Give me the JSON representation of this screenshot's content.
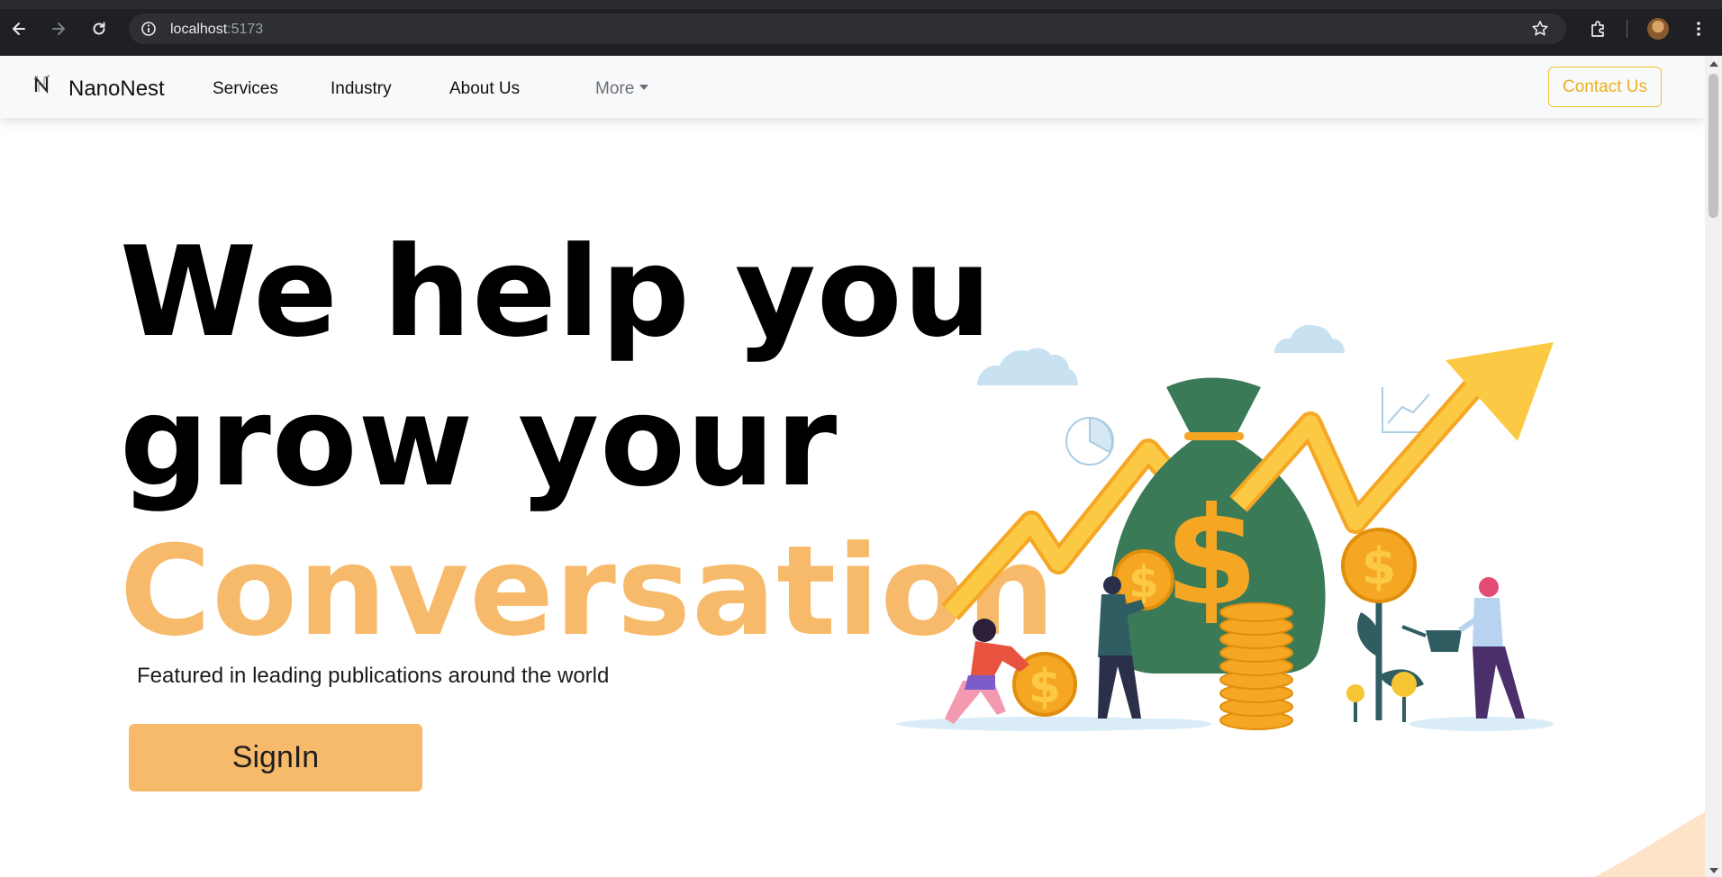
{
  "browser": {
    "url_host": "localhost",
    "url_port": ":5173"
  },
  "navbar": {
    "brand": "NanoNest",
    "links": [
      "Services",
      "Industry",
      "About Us"
    ],
    "more": "More",
    "contact": "Contact Us"
  },
  "hero": {
    "line1": "We help you",
    "line2": "grow your",
    "line3": "Conversation",
    "featured": "Featured in leading publications around the world",
    "signin": "SignIn"
  },
  "colors": {
    "accent": "#f7ba6a",
    "contact_border": "#f2c230",
    "money_bag": "#3b7a57",
    "coin": "#f5a623",
    "arrow": "#f9c232"
  },
  "icons": [
    "back-arrow-icon",
    "forward-arrow-icon",
    "reload-icon",
    "site-info-icon",
    "bookmark-star-icon",
    "extensions-icon",
    "profile-avatar",
    "menu-dots-icon"
  ]
}
